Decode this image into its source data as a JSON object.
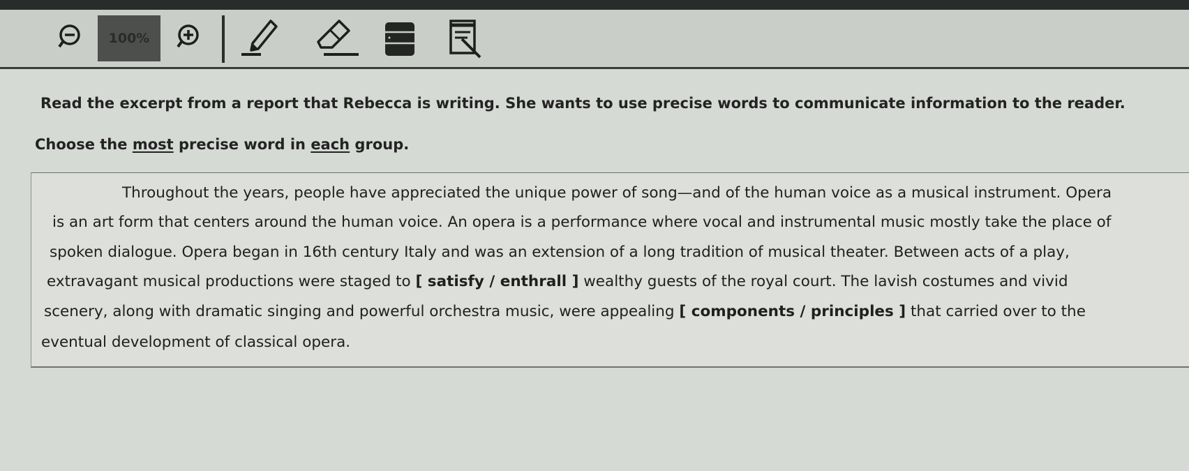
{
  "toolbar": {
    "zoom_level": "100%",
    "icons": [
      "zoom-out-icon",
      "zoom-in-icon",
      "pen-icon",
      "eraser-icon",
      "notes-icon",
      "reference-icon"
    ]
  },
  "instructions": {
    "line1": "Read the excerpt from a report that Rebecca is writing. She wants to use precise words to communicate information to the reader.",
    "line2_before": "Choose the ",
    "line2_most": "most",
    "line2_mid": " precise word in ",
    "line2_each": "each",
    "line2_after": " group."
  },
  "passage": {
    "line1": "Throughout the years, people have appreciated the unique power of song—and of the human voice as a musical instrument. Opera",
    "line2": "is an art form that centers around the human voice. An opera is a performance where vocal and instrumental music mostly take the place of",
    "line3": "spoken dialogue. Opera began in 16th century Italy and was an extension of a long tradition of musical theater. Between acts of a play,",
    "line4_before": "extravagant musical productions were staged to ",
    "line4_after": " wealthy guests of the royal court. The lavish costumes and vivid",
    "line5_before": "scenery, along with dramatic singing and powerful orchestra music, were appealing ",
    "line5_after": " that carried over to the",
    "line6": "eventual development of classical opera."
  },
  "choice_groups": [
    {
      "open": "[ ",
      "options": [
        "satisfy",
        "enthrall"
      ],
      "separator": "  /  ",
      "close": " ]"
    },
    {
      "open": "[ ",
      "options": [
        "components",
        "principles"
      ],
      "separator": "  /  ",
      "close": " ]"
    }
  ],
  "colors": {
    "toolbar_bg": "#c9cec8",
    "content_bg": "#d6dad5",
    "zoom_box": "#4c4f4c"
  }
}
